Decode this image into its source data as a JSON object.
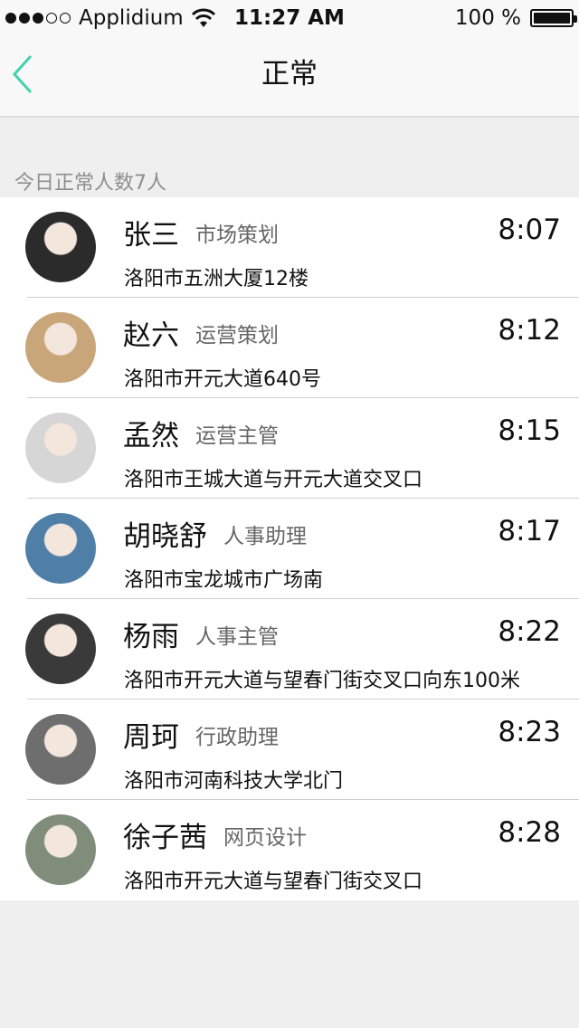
{
  "status_bar": {
    "carrier": "Applidium",
    "time": "11:27 AM",
    "battery": "100 %",
    "icons": [
      "signal-strength-icon",
      "wifi-icon",
      "battery-icon"
    ]
  },
  "nav": {
    "title": "正常",
    "back_icon": "chevron-left-icon"
  },
  "section": {
    "header": "今日正常人数7人"
  },
  "colors": {
    "accent": "#3fd3a6",
    "background": "#efefef",
    "secondary_text": "#8e8e8e"
  },
  "list": [
    {
      "name": "张三",
      "role": "市场策划",
      "time": "8:07",
      "address": "洛阳市五洲大厦12楼",
      "avatar_color": "#2b2b2b"
    },
    {
      "name": "赵六",
      "role": "运营策划",
      "time": "8:12",
      "address": "洛阳市开元大道640号",
      "avatar_color": "#c9a67a"
    },
    {
      "name": "孟然",
      "role": "运营主管",
      "time": "8:15",
      "address": "洛阳市王城大道与开元大道交叉口",
      "avatar_color": "#d6d6d6"
    },
    {
      "name": "胡晓舒",
      "role": "人事助理",
      "time": "8:17",
      "address": "洛阳市宝龙城市广场南",
      "avatar_color": "#4f7fa6"
    },
    {
      "name": "杨雨",
      "role": "人事主管",
      "time": "8:22",
      "address": "洛阳市开元大道与望春门街交叉口向东100米",
      "avatar_color": "#3a3a3a"
    },
    {
      "name": "周珂",
      "role": "行政助理",
      "time": "8:23",
      "address": "洛阳市河南科技大学北门",
      "avatar_color": "#6e6e6e"
    },
    {
      "name": "徐子茜",
      "role": "网页设计",
      "time": "8:28",
      "address": "洛阳市开元大道与望春门街交叉口",
      "avatar_color": "#7f8d7a"
    }
  ]
}
